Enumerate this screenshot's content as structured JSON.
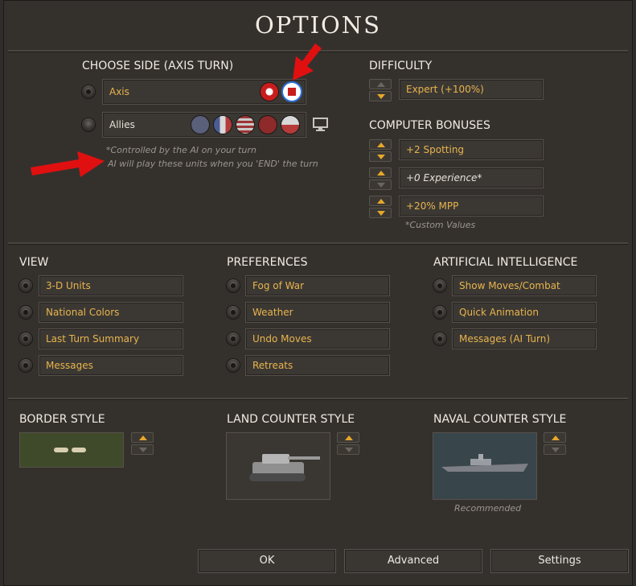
{
  "title": "OPTIONS",
  "choose_side": {
    "heading": "CHOOSE SIDE (AXIS TURN)",
    "axis_label": "Axis",
    "allies_label": "Allies",
    "note_line1": "*Controlled by the AI on your turn",
    "note_line2": "AI will play these units when you 'END' the turn"
  },
  "difficulty": {
    "heading": "DIFFICULTY",
    "value": "Expert (+100%)"
  },
  "computer_bonuses": {
    "heading": "COMPUTER BONUSES",
    "spotting": "+2 Spotting",
    "experience": "+0 Experience*",
    "mpp": "+20% MPP",
    "note": "*Custom Values"
  },
  "view": {
    "heading": "VIEW",
    "items": [
      "3-D Units",
      "National Colors",
      "Last Turn Summary",
      "Messages"
    ]
  },
  "preferences": {
    "heading": "PREFERENCES",
    "items": [
      "Fog of War",
      "Weather",
      "Undo Moves",
      "Retreats"
    ]
  },
  "ai": {
    "heading": "ARTIFICIAL INTELLIGENCE",
    "items": [
      "Show Moves/Combat",
      "Quick Animation",
      "Messages (AI Turn)"
    ]
  },
  "styles": {
    "border": "BORDER STYLE",
    "land": "LAND COUNTER STYLE",
    "naval": "NAVAL COUNTER STYLE",
    "naval_note": "Recommended"
  },
  "buttons": {
    "ok": "OK",
    "advanced": "Advanced",
    "settings": "Settings"
  },
  "colors": {
    "accent": "#e9b44c",
    "arrow": "#e01010"
  }
}
